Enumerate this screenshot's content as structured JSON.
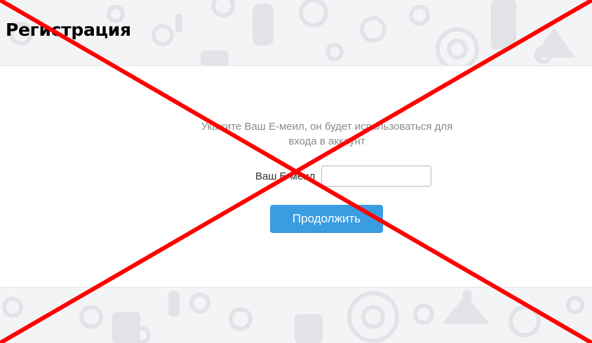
{
  "page": {
    "title": "Регистрация"
  },
  "form": {
    "instruction": "Укажите Ваш Е-меил, он будет использоваться для входа в аккаунт",
    "email_label": "Ваш Е-меил",
    "email_value": "",
    "email_placeholder": "",
    "continue_label": "Продолжить"
  },
  "colors": {
    "background": "#f3f4f6",
    "pattern": "#e1e3e7",
    "panel": "#ffffff",
    "button": "#3b9de1",
    "cross": "#ff0000"
  },
  "icons": {
    "background_pattern": [
      "gear-icon",
      "robot-icon",
      "key-icon",
      "scale-icon",
      "wheel-icon"
    ],
    "overlay": "red-cross-icon"
  }
}
